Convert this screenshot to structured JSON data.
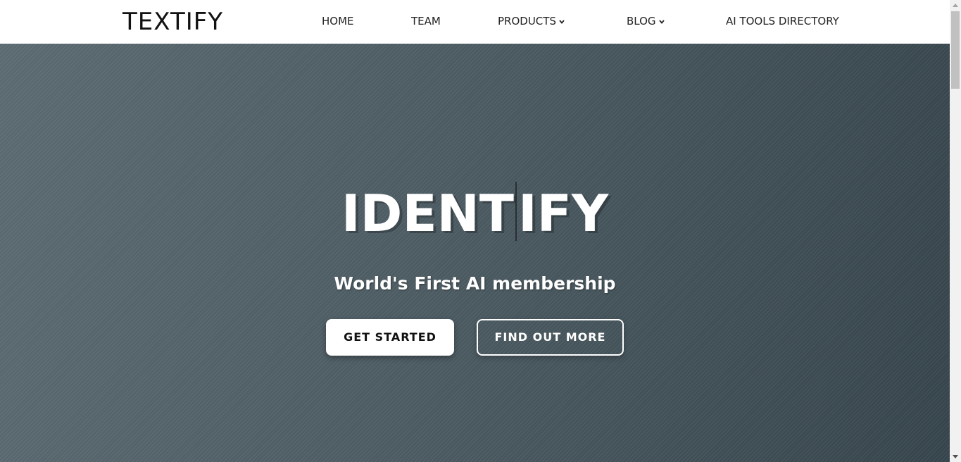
{
  "header": {
    "logo": "TEXTIFY",
    "nav": {
      "home": "HOME",
      "team": "TEAM",
      "products": "PRODUCTS",
      "blog": "BLOG",
      "ai_tools_directory": "AI TOOLS DIRECTORY"
    },
    "dropdown_icon": "chevron-down-icon"
  },
  "hero": {
    "title_before_caret": "IDENT",
    "title_after_caret": "IFY",
    "subtitle": "World's First AI membership",
    "primary_button": "GET STARTED",
    "secondary_button": "FIND OUT MORE",
    "background_color": "#4f5e65"
  },
  "colors": {
    "header_bg": "#ffffff",
    "nav_text": "#222222",
    "hero_text": "#ffffff",
    "primary_button_bg": "#ffffff"
  }
}
